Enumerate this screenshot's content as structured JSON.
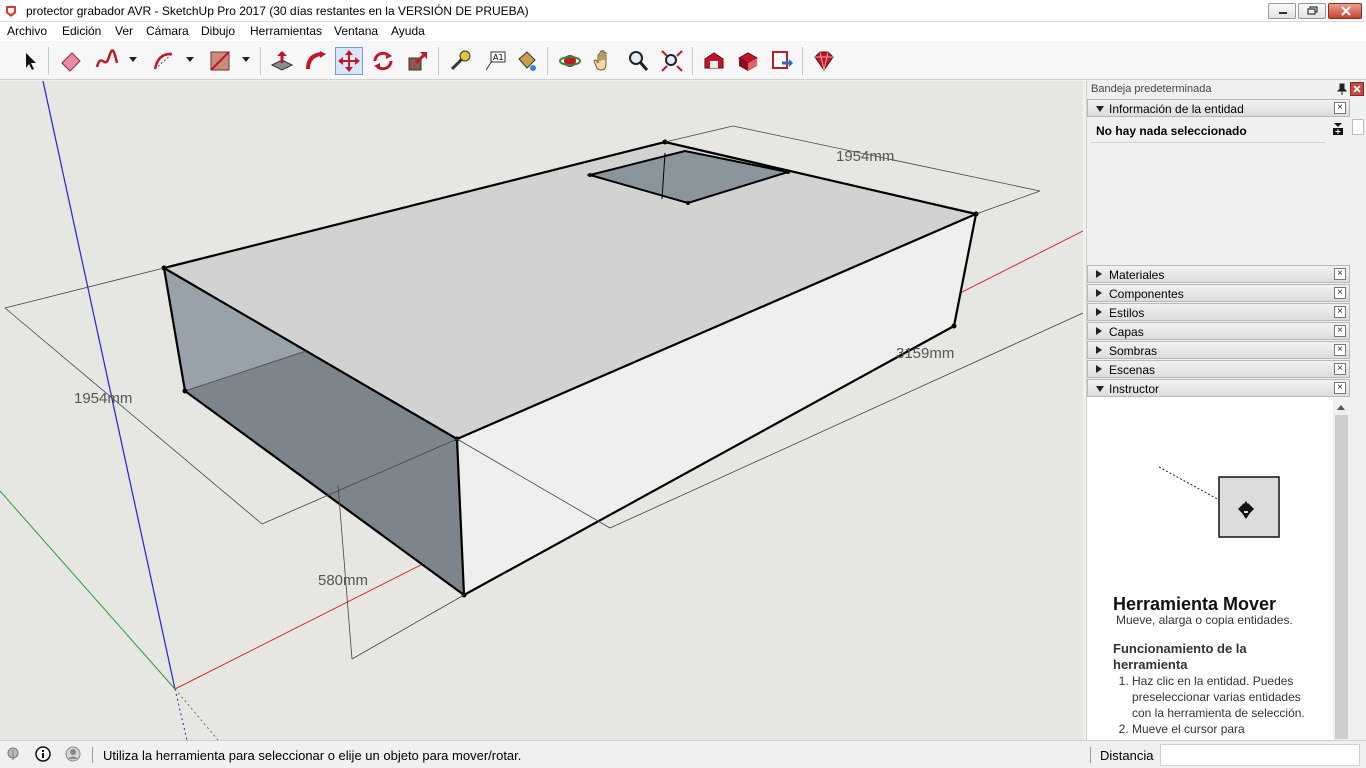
{
  "window": {
    "title": "protector grabador AVR - SketchUp Pro 2017 (30 días restantes en la VERSIÓN DE PRUEBA)",
    "app_icon": "sketchup-icon",
    "controls": [
      "minimize-icon",
      "restore-icon",
      "close-icon"
    ]
  },
  "menu": {
    "items": [
      "Archivo",
      "Edición",
      "Ver",
      "Cámara",
      "Dibujo",
      "Herramientas",
      "Ventana",
      "Ayuda"
    ]
  },
  "toolbar": {
    "tools": [
      "select-arrow-icon",
      "eraser-icon",
      "freehand-icon",
      "arc-icon",
      "rectangle-icon",
      "push-pull-icon",
      "follow-me-icon",
      "move-icon",
      "rotate-icon",
      "scale-icon",
      "tape-measure-icon",
      "text-icon",
      "paint-bucket-icon",
      "orbit-icon",
      "pan-icon",
      "zoom-icon",
      "zoom-extents-icon",
      "warehouse-icon",
      "components-icon",
      "share-model-icon",
      "extension-warehouse-icon"
    ],
    "active_tool": "move-icon"
  },
  "viewport": {
    "dimensions": [
      "1954mm",
      "1954mm",
      "3159mm",
      "580mm"
    ],
    "colors": {
      "background": "#e6e6e2",
      "axis_red": "#d43030",
      "axis_green": "#2f9a2f",
      "axis_blue": "#2323d0",
      "top_face": "#d2d2d2",
      "front_face": "#efefef",
      "back_face": "#7c858c"
    }
  },
  "tray": {
    "title": "Bandeja predeterminada",
    "entity_info": {
      "header": "Información de la entidad",
      "empty_text": "No hay nada seleccionado"
    },
    "panels": [
      "Materiales",
      "Componentes",
      "Estilos",
      "Capas",
      "Sombras",
      "Escenas"
    ],
    "instructor": {
      "header": "Instructor",
      "tool_title": "Herramienta Mover",
      "tool_subtitle": "Mueve, alarga o copia entidades.",
      "section_title": "Funcionamiento de la herramienta",
      "steps": [
        "Haz clic en la entidad. Puedes preseleccionar varias entidades con la herramienta de selección.",
        "Mueve el cursor para"
      ]
    }
  },
  "status": {
    "message": "Utiliza la herramienta para seleccionar o elije un objeto para mover/rotar.",
    "measurement_label": "Distancia",
    "measurement_value": ""
  }
}
